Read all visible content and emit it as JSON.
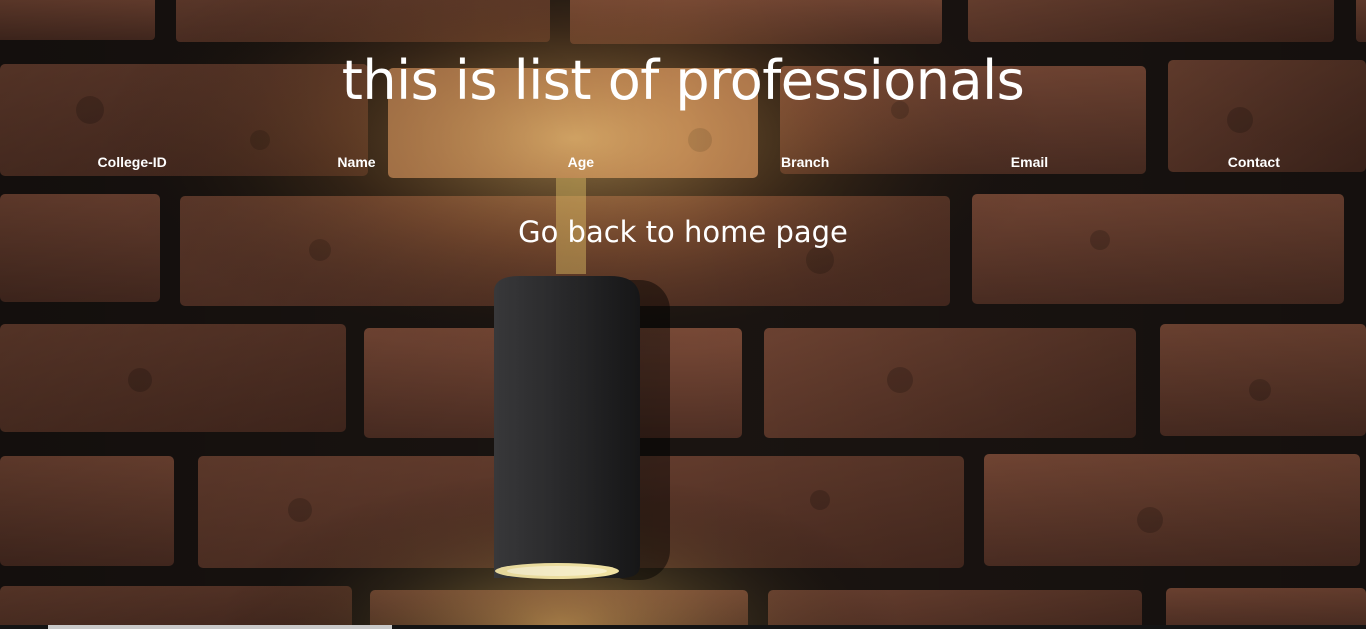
{
  "page": {
    "heading": "this is list of professionals",
    "home_link": "Go back to home page"
  },
  "table": {
    "columns": [
      "College-ID",
      "Name",
      "Age",
      "Branch",
      "Email",
      "Contact"
    ]
  },
  "background": {
    "subject": "brick-wall-with-wall-lamp",
    "brick_color": "#6b3f2e",
    "mortar_color": "#1a1411",
    "lamp_color": "#2a2a2c",
    "light_color": "#f6e7a6"
  }
}
